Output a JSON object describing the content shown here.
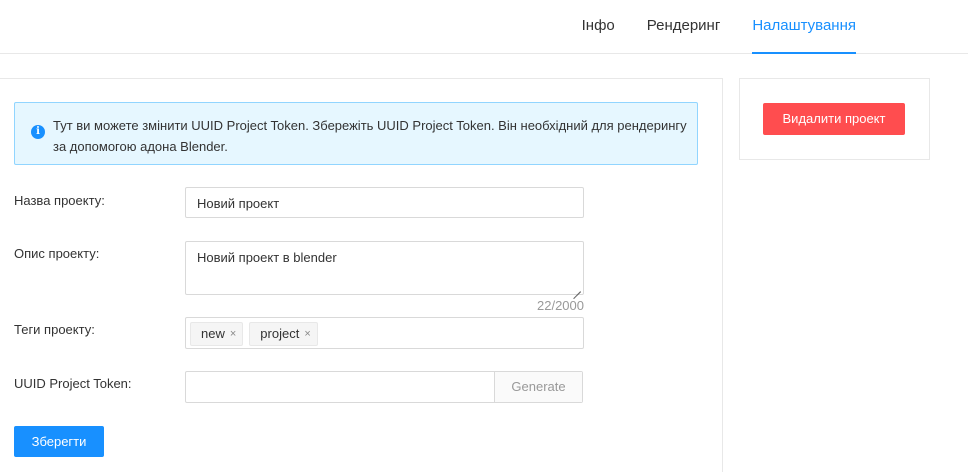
{
  "tabs": [
    {
      "label": "Інфо",
      "active": false
    },
    {
      "label": "Рендеринг",
      "active": false
    },
    {
      "label": "Налаштування",
      "active": true
    }
  ],
  "alert": {
    "icon": "info-circle-icon",
    "text": "Тут ви можете змінити UUID Project Token. Збережіть UUID Project Token. Він необхідний для рендерингу за допомогою адона Blender."
  },
  "form": {
    "name": {
      "label": "Назва проекту:",
      "value": "Новий проект"
    },
    "description": {
      "label": "Опис проекту:",
      "value": "Новий проект в blender",
      "counter": "22/2000"
    },
    "tags": {
      "label": "Теги проекту:",
      "items": [
        "new",
        "project"
      ],
      "remove_glyph": "×"
    },
    "token": {
      "label": "UUID Project Token:",
      "value": "",
      "generate_label": "Generate"
    },
    "save_label": "Зберегти"
  },
  "sidebar": {
    "delete_label": "Видалити проект"
  },
  "colors": {
    "accent": "#1890ff",
    "danger": "#ff4d4f",
    "alert_bg": "#e6f7ff",
    "alert_border": "#91d5ff"
  }
}
